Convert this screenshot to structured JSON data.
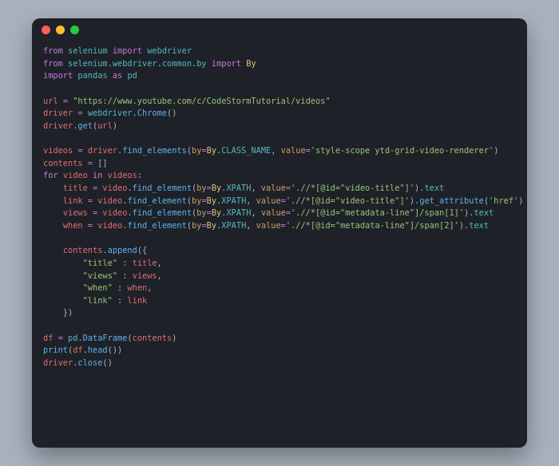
{
  "window": {
    "dots": {
      "close": "close",
      "minimize": "minimize",
      "maximize": "maximize"
    }
  },
  "code": {
    "l1": {
      "from": "from",
      "mod1": "selenium",
      "imp": "import",
      "mod2": "webdriver"
    },
    "l2": {
      "from": "from",
      "mod1": "selenium",
      "mod2": "webdriver",
      "mod3": "common",
      "mod4": "by",
      "imp": "import",
      "cls": "By"
    },
    "l3": {
      "imp": "import",
      "mod1": "pandas",
      "as": "as",
      "alias": "pd"
    },
    "l5": {
      "var": "url",
      "eq": "=",
      "str": "\"https://www.youtube.com/c/CodeStormTutorial/videos\""
    },
    "l6": {
      "var": "driver",
      "eq": "=",
      "mod": "webdriver",
      "fn": "Chrome",
      "paren": "()"
    },
    "l7": {
      "var": "driver",
      "fn": "get",
      "arg": "url"
    },
    "l9": {
      "var": "videos",
      "eq": "=",
      "drv": "driver",
      "fn": "find_elements",
      "byp": "by",
      "eq2": "=",
      "byc": "By",
      "attr": "CLASS_NAME",
      "valp": "value",
      "eq3": "=",
      "str": "'style-scope ytd-grid-video-renderer'"
    },
    "l10": {
      "var": "contents",
      "eq": "=",
      "br": "[]"
    },
    "l11": {
      "for": "for",
      "v": "video",
      "in": "in",
      "it": "videos",
      "col": ":"
    },
    "l12": {
      "var": "title",
      "eq": "=",
      "obj": "video",
      "fn": "find_element",
      "byp": "by",
      "byc": "By",
      "attr": "XPATH",
      "valp": "value",
      "str": "'.//*[@id=\"video-title\"]'",
      "tail": "text"
    },
    "l13": {
      "var": "link",
      "eq": "=",
      "obj": "video",
      "fn": "find_element",
      "byp": "by",
      "byc": "By",
      "attr": "XPATH",
      "valp": "value",
      "str": "'.//*[@id=\"video-title\"]'",
      "fn2": "get_attribute",
      "arg2": "'href'"
    },
    "l14": {
      "var": "views",
      "eq": "=",
      "obj": "video",
      "fn": "find_element",
      "byp": "by",
      "byc": "By",
      "attr": "XPATH",
      "valp": "value",
      "str": "'.//*[@id=\"metadata-line\"]/span[1]'",
      "tail": "text"
    },
    "l15": {
      "var": "when",
      "eq": "=",
      "obj": "video",
      "fn": "find_element",
      "byp": "by",
      "byc": "By",
      "attr": "XPATH",
      "valp": "value",
      "str": "'.//*[@id=\"metadata-line\"]/span[2]'",
      "tail": "text"
    },
    "l17": {
      "obj": "contents",
      "fn": "append",
      "open": "({"
    },
    "l18": {
      "key": "\"title\"",
      "col": ":",
      "val": "title",
      "com": ","
    },
    "l19": {
      "key": "\"views\"",
      "col": ":",
      "val": "views",
      "com": ","
    },
    "l20": {
      "key": "\"when\"",
      "col": ":",
      "val": "when",
      "com": ","
    },
    "l21": {
      "key": "\"link\"",
      "col": ":",
      "val": "link"
    },
    "l22": {
      "close": "})"
    },
    "l24": {
      "var": "df",
      "eq": "=",
      "mod": "pd",
      "fn": "DataFrame",
      "arg": "contents"
    },
    "l25": {
      "fn": "print",
      "obj": "df",
      "fn2": "head",
      "paren": "()"
    },
    "l26": {
      "obj": "driver",
      "fn": "close",
      "paren": "()"
    }
  }
}
